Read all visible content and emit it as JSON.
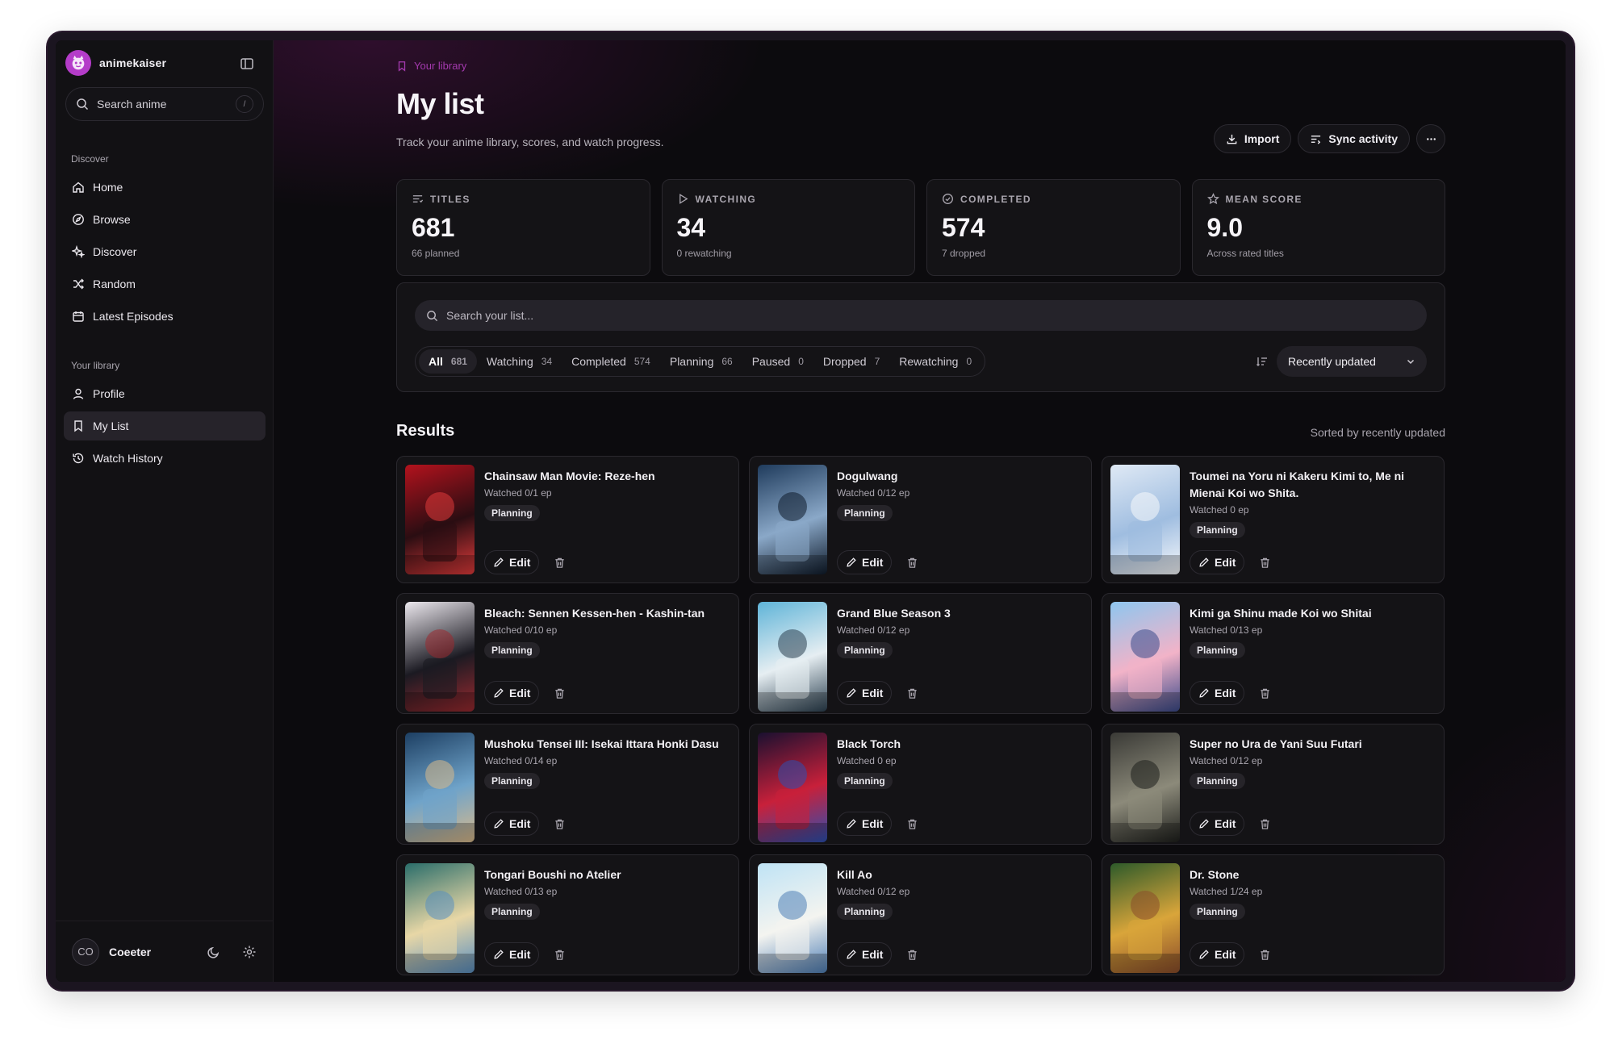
{
  "app": {
    "brand": "animekaiser"
  },
  "sidebar": {
    "search_placeholder": "Search anime",
    "search_shortcut": "/",
    "discover_heading": "Discover",
    "discover_items": [
      {
        "label": "Home",
        "icon": "home-icon"
      },
      {
        "label": "Browse",
        "icon": "compass-icon"
      },
      {
        "label": "Discover",
        "icon": "sparkles-icon"
      },
      {
        "label": "Random",
        "icon": "shuffle-icon"
      },
      {
        "label": "Latest Episodes",
        "icon": "calendar-icon"
      }
    ],
    "library_heading": "Your library",
    "library_items": [
      {
        "label": "Profile",
        "icon": "user-icon"
      },
      {
        "label": "My List",
        "icon": "bookmark-icon",
        "active": true
      },
      {
        "label": "Watch History",
        "icon": "history-icon"
      }
    ],
    "user": {
      "initials": "CO",
      "name": "Coeeter"
    }
  },
  "header": {
    "breadcrumb": "Your library",
    "title": "My list",
    "subtitle": "Track your anime library, scores, and watch progress.",
    "import_label": "Import",
    "sync_label": "Sync activity"
  },
  "stats": [
    {
      "label": "TITLES",
      "value": "681",
      "sub": "66 planned",
      "icon": "list-icon"
    },
    {
      "label": "WATCHING",
      "value": "34",
      "sub": "0 rewatching",
      "icon": "play-icon"
    },
    {
      "label": "COMPLETED",
      "value": "574",
      "sub": "7 dropped",
      "icon": "check-circle-icon"
    },
    {
      "label": "MEAN SCORE",
      "value": "9.0",
      "sub": "Across rated titles",
      "icon": "star-icon"
    }
  ],
  "filters": {
    "search_placeholder": "Search your list...",
    "tabs": [
      {
        "label": "All",
        "count": "681",
        "active": true
      },
      {
        "label": "Watching",
        "count": "34"
      },
      {
        "label": "Completed",
        "count": "574"
      },
      {
        "label": "Planning",
        "count": "66"
      },
      {
        "label": "Paused",
        "count": "0"
      },
      {
        "label": "Dropped",
        "count": "7"
      },
      {
        "label": "Rewatching",
        "count": "0"
      }
    ],
    "sort_value": "Recently updated"
  },
  "results": {
    "title": "Results",
    "sort_note": "Sorted by recently updated",
    "edit_label": "Edit",
    "items": [
      {
        "title": "Chainsaw Man Movie: Reze-hen",
        "progress": "Watched 0/1 ep",
        "status": "Planning",
        "colors": [
          "#b3121d",
          "#2a0d12",
          "#e23b3b"
        ]
      },
      {
        "title": "Dogulwang",
        "progress": "Watched 0/12 ep",
        "status": "Planning",
        "colors": [
          "#1f3b5c",
          "#8aa8c8",
          "#0f1b2b"
        ]
      },
      {
        "title": "Toumei na Yoru ni Kakeru Kimi to, Me ni Mienai Koi wo Shita.",
        "progress": "Watched 0 ep",
        "status": "Planning",
        "colors": [
          "#dfe9f5",
          "#9fbde0",
          "#f7f9fc"
        ]
      },
      {
        "title": "Bleach: Sennen Kessen-hen - Kashin-tan",
        "progress": "Watched 0/10 ep",
        "status": "Planning",
        "colors": [
          "#ece8ee",
          "#1b1a22",
          "#9a2a30"
        ]
      },
      {
        "title": "Grand Blue Season 3",
        "progress": "Watched 0/12 ep",
        "status": "Planning",
        "colors": [
          "#5fb4d8",
          "#e6eef2",
          "#2b4050"
        ]
      },
      {
        "title": "Kimi ga Shinu made Koi wo Shitai",
        "progress": "Watched 0/13 ep",
        "status": "Planning",
        "colors": [
          "#8ec6ef",
          "#f2b3c8",
          "#3b4a8a"
        ]
      },
      {
        "title": "Mushoku Tensei III: Isekai Ittara Honki Dasu",
        "progress": "Watched 0/14 ep",
        "status": "Planning",
        "colors": [
          "#1d3f63",
          "#6fa3c9",
          "#d9b98a"
        ]
      },
      {
        "title": "Black Torch",
        "progress": "Watched 0 ep",
        "status": "Planning",
        "colors": [
          "#1a1030",
          "#c8203a",
          "#2d4fb0"
        ]
      },
      {
        "title": "Super no Ura de Yani Suu Futari",
        "progress": "Watched 0/12 ep",
        "status": "Planning",
        "colors": [
          "#3a3a36",
          "#8c8a7a",
          "#1e1f1c"
        ]
      },
      {
        "title": "Tongari Boushi no Atelier",
        "progress": "Watched 0/13 ep",
        "status": "Planning",
        "colors": [
          "#2a6d6a",
          "#e8d7a6",
          "#5a8fc0"
        ]
      },
      {
        "title": "Kill Ao",
        "progress": "Watched 0/12 ep",
        "status": "Planning",
        "colors": [
          "#bfe3f5",
          "#f4f4f0",
          "#4f7fb6"
        ]
      },
      {
        "title": "Dr. Stone",
        "progress": "Watched 1/24 ep",
        "status": "Planning",
        "colors": [
          "#2d5a2a",
          "#d9a53a",
          "#8a4c2a"
        ]
      }
    ]
  }
}
